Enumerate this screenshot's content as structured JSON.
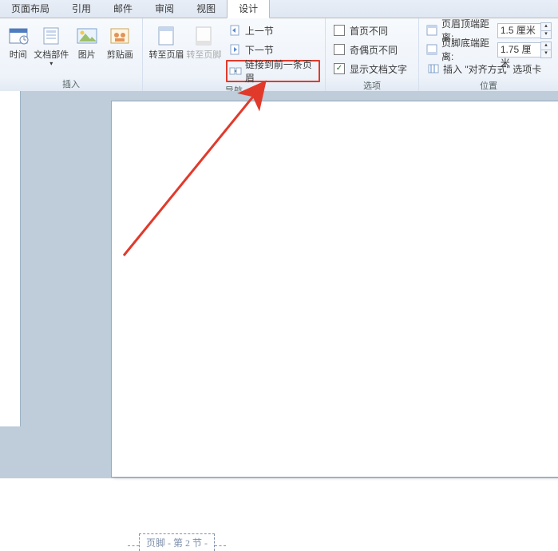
{
  "tabs": {
    "layout": "页面布局",
    "reference": "引用",
    "mail": "邮件",
    "review": "审阅",
    "view": "视图",
    "design": "设计"
  },
  "groups": {
    "insert": {
      "label": "插入",
      "datetime": "时间",
      "quickparts": "文档部件",
      "picture": "图片",
      "clipart": "剪贴画"
    },
    "nav": {
      "label": "导航",
      "goto_header": "转至页眉",
      "goto_footer": "转至页脚",
      "prev_section": "上一节",
      "next_section": "下一节",
      "link_previous": "链接到前一条页眉"
    },
    "options": {
      "label": "选项",
      "first_page_diff": "首页不同",
      "odd_even_diff": "奇偶页不同",
      "show_doc_text": "显示文档文字"
    },
    "position": {
      "label": "位置",
      "header_top": "页眉顶端距离:",
      "header_top_val": "1.5 厘米",
      "footer_bottom": "页脚底端距离:",
      "footer_bottom_val": "1.75 厘米",
      "insert_align_tab": "插入 \"对齐方式\" 选项卡"
    }
  },
  "footer_marker": "页脚 - 第 2 节 -"
}
